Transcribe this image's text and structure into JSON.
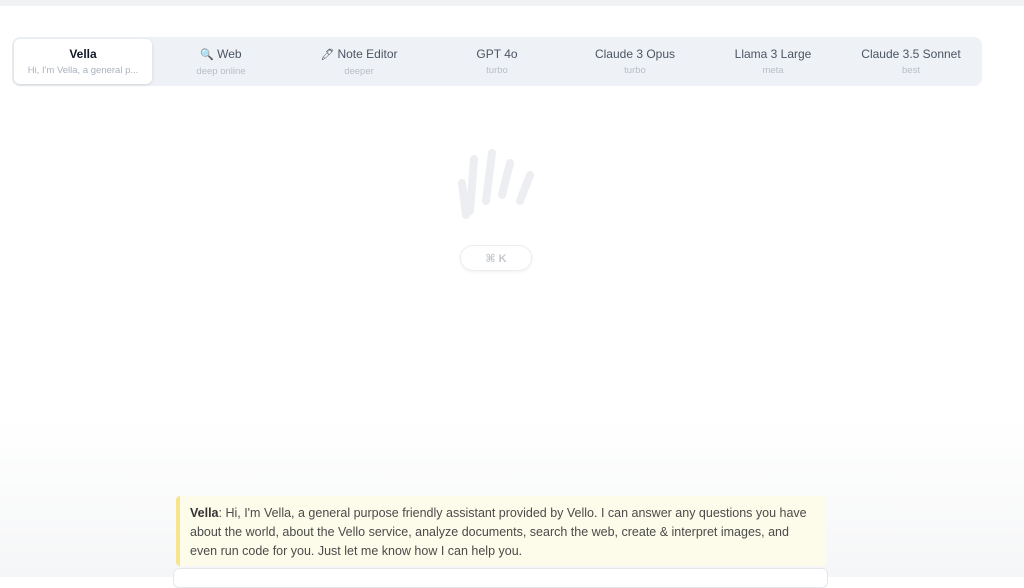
{
  "tabs": [
    {
      "label": "Vella",
      "sub": "Hi, I'm Vella, a general p...",
      "icon": "",
      "active": true
    },
    {
      "label": "Web",
      "sub": "deep online",
      "icon": "magnifier-icon",
      "glyph": "🔍",
      "active": false
    },
    {
      "label": "Note Editor",
      "sub": "deeper",
      "icon": "pencil-icon",
      "glyph": "🖊",
      "active": false
    },
    {
      "label": "GPT 4o",
      "sub": "turbo",
      "icon": "",
      "active": false
    },
    {
      "label": "Claude 3 Opus",
      "sub": "turbo",
      "icon": "",
      "active": false
    },
    {
      "label": "Llama 3 Large",
      "sub": "meta",
      "icon": "",
      "active": false
    },
    {
      "label": "Claude 3.5 Sonnet",
      "sub": "best",
      "icon": "",
      "active": false
    }
  ],
  "center": {
    "logo_icon": "waving-hand-icon",
    "shortcut": "⌘ K"
  },
  "message": {
    "sender": "Vella",
    "text": ": Hi, I'm Vella, a general purpose friendly assistant provided by Vello. I can answer any questions you have about the world, about the Vello service, analyze documents, search the web, create & interpret images, and even run code for you. Just let me know how I can help you."
  },
  "colors": {
    "tab_bar_bg": "#eef1f5",
    "message_bg": "#fdfbea",
    "message_accent": "#f6e58d"
  }
}
